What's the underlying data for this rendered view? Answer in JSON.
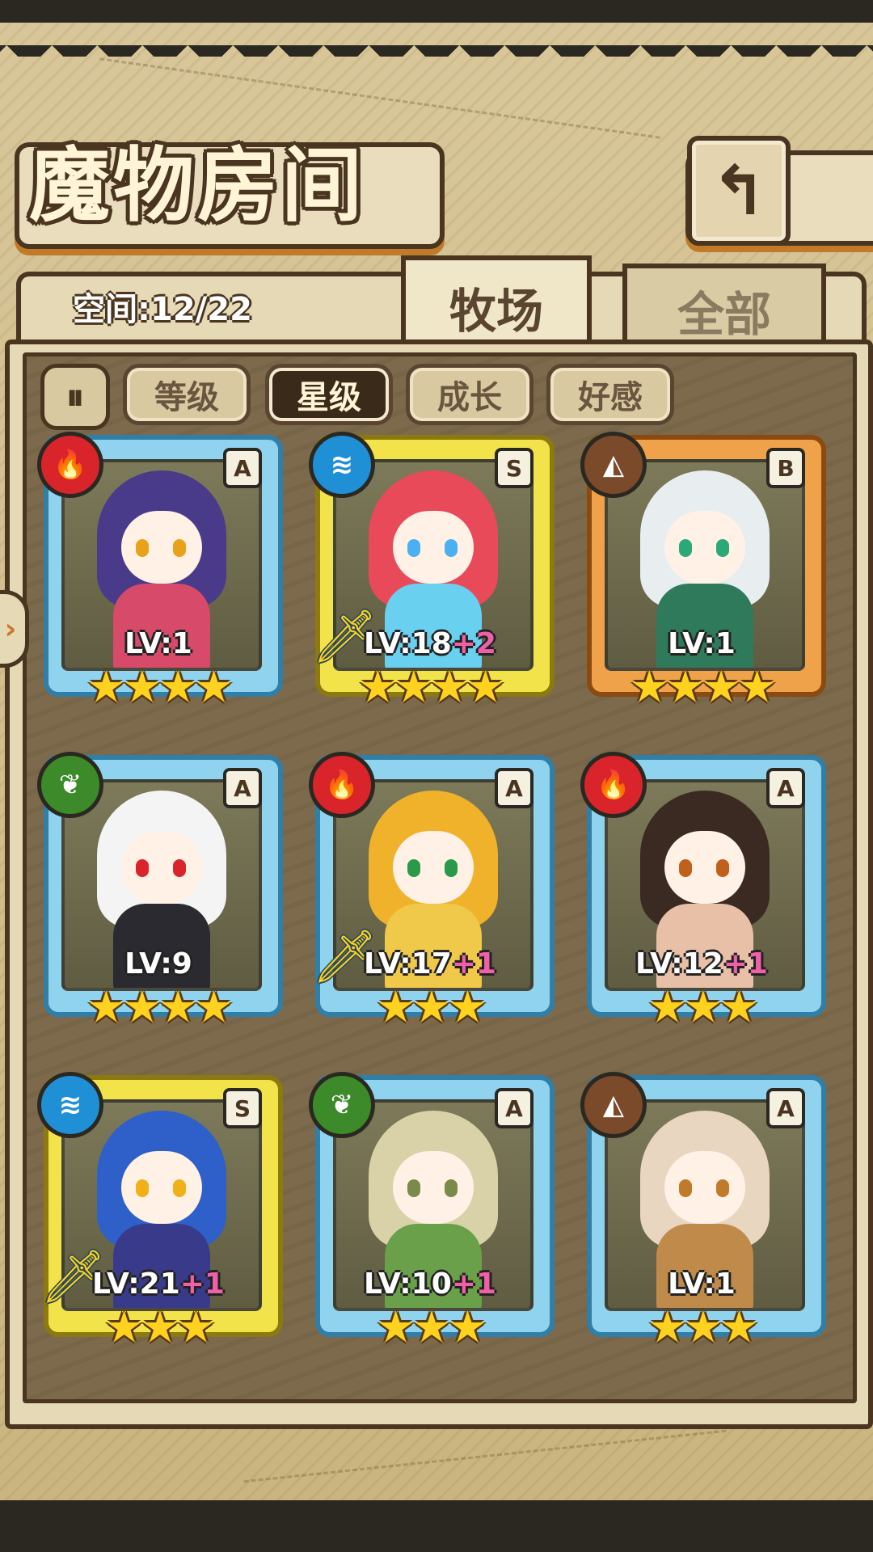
{
  "header": {
    "title": "魔物房间",
    "back_icon": "return-arrow-icon"
  },
  "storage": {
    "space_label": "空间:12/22"
  },
  "tabs": [
    {
      "label": "牧场",
      "active": true
    },
    {
      "label": "全部",
      "active": false
    }
  ],
  "sort": {
    "toggle_icon": "sort-order-icon",
    "buttons": [
      {
        "label": "等级",
        "active": false
      },
      {
        "label": "星级",
        "active": true
      },
      {
        "label": "成长",
        "active": false
      },
      {
        "label": "好感",
        "active": false
      }
    ]
  },
  "monsters": [
    {
      "level": "LV:1",
      "plus": "",
      "rank": "A",
      "element": "fire",
      "stars": 4,
      "weapon": false
    },
    {
      "level": "LV:18",
      "plus": "+2",
      "rank": "S",
      "element": "water",
      "stars": 4,
      "weapon": true
    },
    {
      "level": "LV:1",
      "plus": "",
      "rank": "B",
      "element": "earth",
      "stars": 4,
      "weapon": false
    },
    {
      "level": "LV:9",
      "plus": "",
      "rank": "A",
      "element": "wood",
      "stars": 4,
      "weapon": false
    },
    {
      "level": "LV:17",
      "plus": "+1",
      "rank": "A",
      "element": "fire",
      "stars": 3,
      "weapon": true
    },
    {
      "level": "LV:12",
      "plus": "+1",
      "rank": "A",
      "element": "fire",
      "stars": 3,
      "weapon": false
    },
    {
      "level": "LV:21",
      "plus": "+1",
      "rank": "S",
      "element": "water",
      "stars": 3,
      "weapon": true
    },
    {
      "level": "LV:10",
      "plus": "+1",
      "rank": "A",
      "element": "wood",
      "stars": 3,
      "weapon": false
    },
    {
      "level": "LV:1",
      "plus": "",
      "rank": "A",
      "element": "earth",
      "stars": 3,
      "weapon": false
    }
  ],
  "colors": {
    "fire": "#d8242a",
    "water": "#1f8fd6",
    "wood": "#3c8a2a",
    "earth": "#7a4a2a",
    "accent_brown": "#4a3520"
  }
}
